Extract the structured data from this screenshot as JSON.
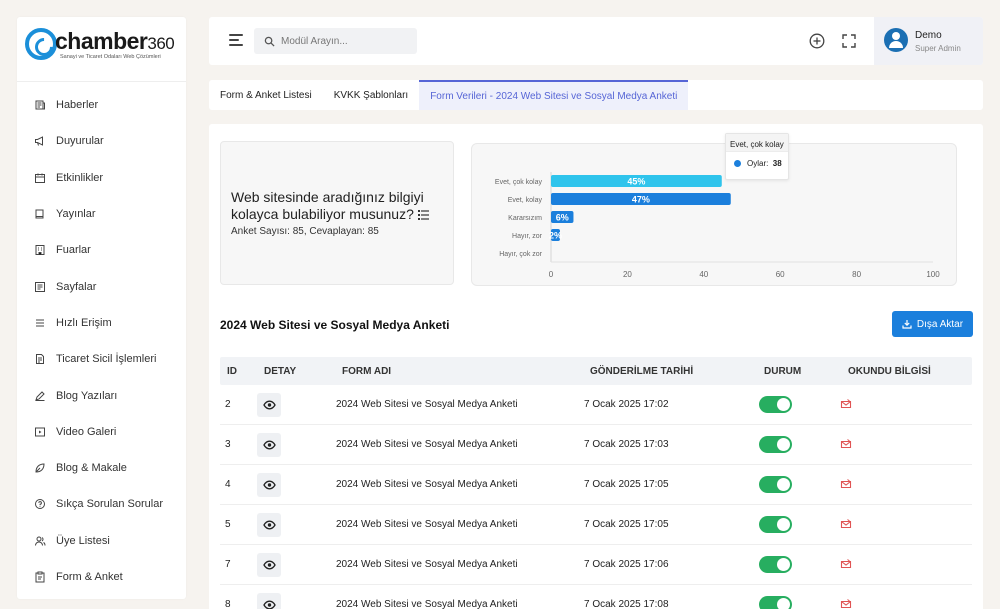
{
  "brand": {
    "name": "chamber",
    "number": "360",
    "tagline": "Sanayi ve Ticaret Odaları Web Çözümleri"
  },
  "sidebar": {
    "items": [
      {
        "label": "Haberler",
        "icon": "news-icon"
      },
      {
        "label": "Duyurular",
        "icon": "megaphone-icon"
      },
      {
        "label": "Etkinlikler",
        "icon": "calendar-icon"
      },
      {
        "label": "Yayınlar",
        "icon": "book-icon"
      },
      {
        "label": "Fuarlar",
        "icon": "building-icon"
      },
      {
        "label": "Sayfalar",
        "icon": "page-icon"
      },
      {
        "label": "Hızlı Erişim",
        "icon": "list-icon"
      },
      {
        "label": "Ticaret Sicil İşlemleri",
        "icon": "document-icon"
      },
      {
        "label": "Blog Yazıları",
        "icon": "pen-icon"
      },
      {
        "label": "Video Galeri",
        "icon": "video-icon"
      },
      {
        "label": "Blog & Makale",
        "icon": "leaf-icon"
      },
      {
        "label": "Sıkça Sorulan Sorular",
        "icon": "question-icon"
      },
      {
        "label": "Üye Listesi",
        "icon": "users-icon"
      },
      {
        "label": "Form & Anket",
        "icon": "clipboard-icon"
      }
    ]
  },
  "topbar": {
    "search_placeholder": "Modül Arayın...",
    "user_name": "Demo",
    "user_role": "Super Admin"
  },
  "tabs": [
    {
      "label": "Form & Anket Listesi",
      "active": false
    },
    {
      "label": "KVKK Şablonları",
      "active": false
    },
    {
      "label": "Form Verileri - 2024 Web Sitesi ve Sosyal Medya Anketi",
      "active": true
    }
  ],
  "question": {
    "title": "Web sitesinde aradığınız bilgiyi kolayca bulabiliyor musunuz?",
    "stats": "Anket Sayısı: 85, Cevaplayan: 85"
  },
  "chart_data": {
    "type": "bar",
    "orientation": "horizontal",
    "categories": [
      "Evet, çok kolay",
      "Evet, kolay",
      "Kararsızım",
      "Hayır, zor",
      "Hayır, çok zor"
    ],
    "series": [
      {
        "name": "Oylar",
        "values": [
          38,
          40,
          5,
          2,
          0
        ]
      }
    ],
    "data_labels": [
      "45%",
      "47%",
      "6%",
      "2%",
      ""
    ],
    "xlim": [
      0,
      100
    ],
    "xticks": [
      0,
      20,
      40,
      60,
      80,
      100
    ],
    "colors": [
      "#2fc4ec",
      "#1b7fdc",
      "#1b7fdc",
      "#1b7fdc",
      "#1b7fdc"
    ],
    "tooltip": {
      "title": "Evet, çok kolay",
      "series": "Oylar",
      "value": "38"
    }
  },
  "section": {
    "title": "2024 Web Sitesi ve Sosyal Medya Anketi",
    "export_label": "Dışa Aktar"
  },
  "table": {
    "headers": [
      "ID",
      "DETAY",
      "FORM ADI",
      "GÖNDERİLME TARİHİ",
      "DURUM",
      "OKUNDU BİLGİSİ"
    ],
    "rows": [
      {
        "id": "2",
        "form": "2024 Web Sitesi ve Sosyal Medya Anketi",
        "date": "7 Ocak 2025 17:02"
      },
      {
        "id": "3",
        "form": "2024 Web Sitesi ve Sosyal Medya Anketi",
        "date": "7 Ocak 2025 17:03"
      },
      {
        "id": "4",
        "form": "2024 Web Sitesi ve Sosyal Medya Anketi",
        "date": "7 Ocak 2025 17:05"
      },
      {
        "id": "5",
        "form": "2024 Web Sitesi ve Sosyal Medya Anketi",
        "date": "7 Ocak 2025 17:05"
      },
      {
        "id": "7",
        "form": "2024 Web Sitesi ve Sosyal Medya Anketi",
        "date": "7 Ocak 2025 17:06"
      },
      {
        "id": "8",
        "form": "2024 Web Sitesi ve Sosyal Medya Anketi",
        "date": "7 Ocak 2025 17:08"
      }
    ]
  }
}
